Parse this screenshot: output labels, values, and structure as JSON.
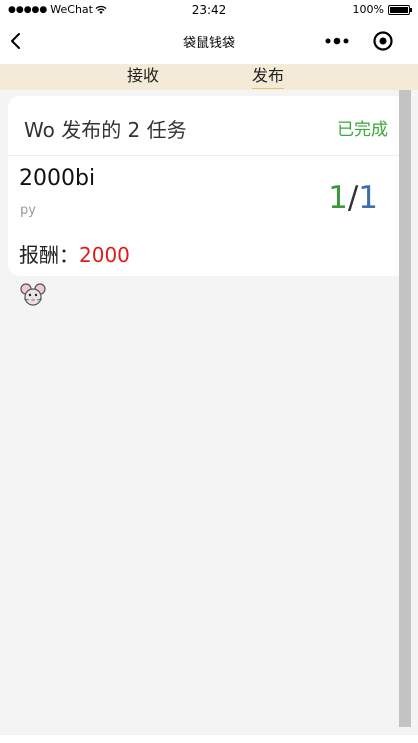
{
  "status_bar": {
    "signal": "●●●●●",
    "carrier": "WeChat",
    "time": "23:42",
    "battery_pct": "100%"
  },
  "nav": {
    "title": "袋鼠钱袋",
    "back_icon": "chevron-left-icon",
    "more_icon": "more-dots-icon",
    "close_icon": "target-circle-icon"
  },
  "tabs": [
    {
      "label": "接收",
      "active": false
    },
    {
      "label": "发布",
      "active": true
    }
  ],
  "card": {
    "title": "Wo 发布的 2 任务",
    "status": "已完成",
    "task": {
      "name": "2000bi",
      "author": "py",
      "progress_done": "1",
      "progress_sep": "/",
      "progress_total": "1",
      "reward_label": "报酬：",
      "reward_value": "2000"
    }
  },
  "colors": {
    "tab_bar_bg": "#f3ead7",
    "status_green": "#3aa83a",
    "reward_red": "#e01b1b",
    "progress_blue": "#3d6fb0"
  }
}
